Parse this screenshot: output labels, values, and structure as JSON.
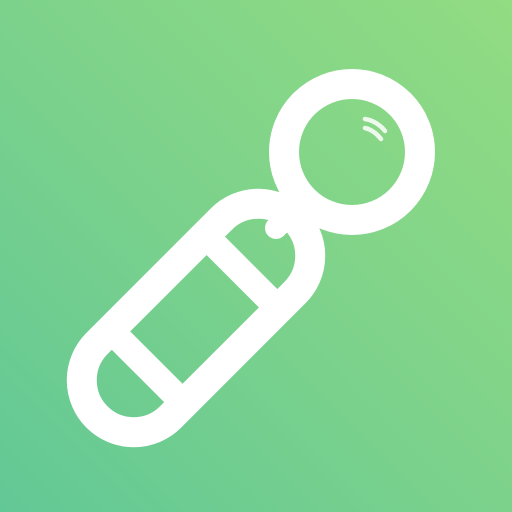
{
  "icon": {
    "name": "magnifier-tool-icon",
    "background_gradient": [
      "#92dc82",
      "#62c896"
    ],
    "glyph_color": "#ffffff"
  }
}
